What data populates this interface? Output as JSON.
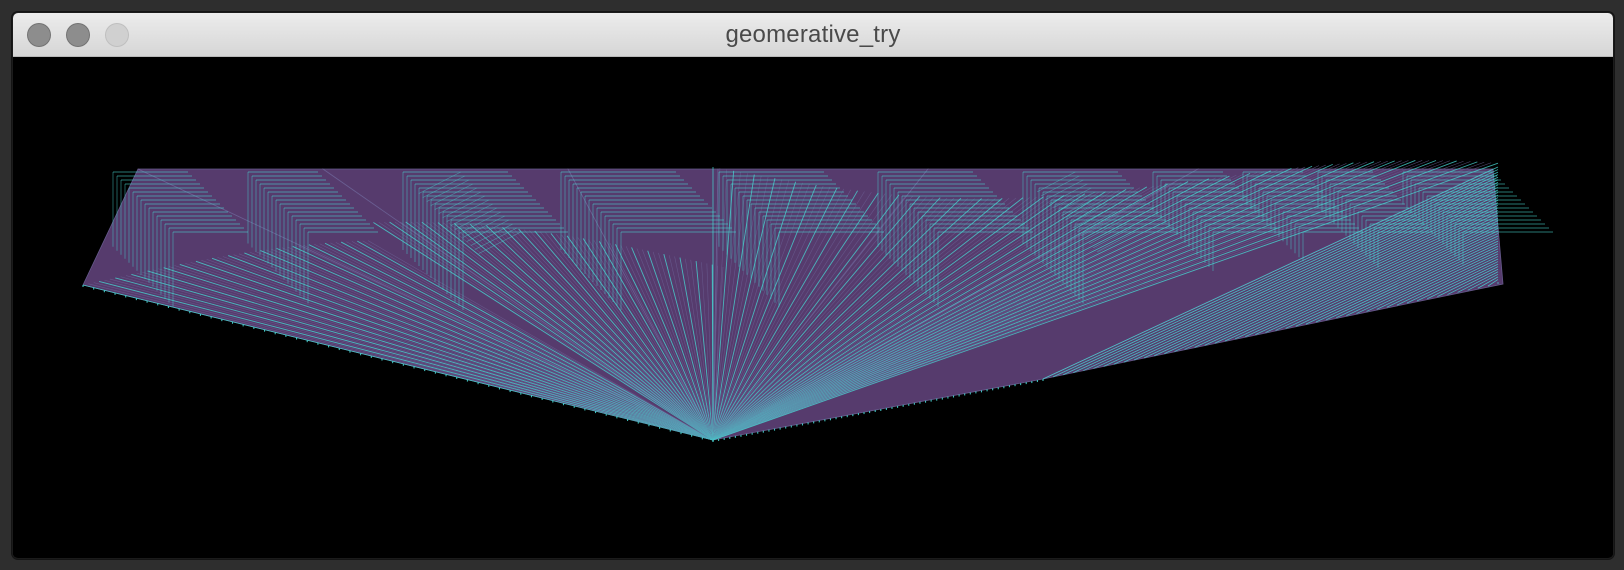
{
  "window": {
    "title": "geomerative_try",
    "buttons": [
      {
        "name": "close-button",
        "state": "inactive"
      },
      {
        "name": "minimize-button",
        "state": "inactive"
      },
      {
        "name": "zoom-button",
        "state": "disabled"
      }
    ]
  },
  "canvas": {
    "background": "#000000",
    "fill_color": "#5b3f73",
    "stroke_color": "#48d6d2",
    "secondary_stroke": "#6b5f93"
  }
}
